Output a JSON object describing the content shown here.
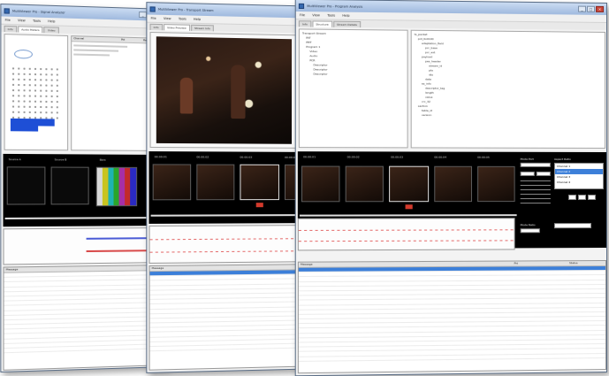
{
  "windows": {
    "a": {
      "title": "MultiViewer Pro - Signal Analyzer",
      "menu": [
        "File",
        "View",
        "Tools",
        "Help"
      ],
      "tabs": [
        "Info",
        "Audio Meters",
        "Video"
      ],
      "list_header": [
        "Channel",
        "Pid",
        "Rate"
      ],
      "thumb_labels": [
        "Source A",
        "Source B",
        "Bars"
      ],
      "log_header": "Message"
    },
    "b": {
      "title": "MultiViewer Pro - Transport Stream",
      "menu": [
        "File",
        "View",
        "Tools",
        "Help"
      ],
      "tabs": [
        "Info",
        "Video Preview",
        "Stream Info"
      ],
      "thumb_labels": [
        "00:00:01",
        "00:00:02",
        "00:00:03",
        "00:00:04"
      ],
      "log_header": "Message"
    },
    "c": {
      "title": "MultiViewer Pro - Program Analysis",
      "menu": [
        "File",
        "View",
        "Tools",
        "Help"
      ],
      "tabs": [
        "Info",
        "Structure",
        "Stream Details"
      ],
      "tree_left": [
        "Transport Stream",
        "PAT",
        "PMT",
        "Program 1",
        "Video",
        "Audio",
        "PCR",
        "Descriptor",
        "Descriptor",
        "Descriptor"
      ],
      "tree_right": [
        "ts_packet",
        "pid_0x0100",
        "adaptation_field",
        "pcr_base",
        "pcr_ext",
        "payload",
        "pes_header",
        "stream_id",
        "pts",
        "dts",
        "data",
        "es_info",
        "descriptor_tag",
        "length",
        "value",
        "crc_32",
        "section",
        "table_id",
        "version"
      ],
      "thumb_labels": [
        "00:00:01",
        "00:00:02",
        "00:00:03",
        "00:00:04",
        "00:00:05"
      ],
      "side_labels": [
        "Mode Port",
        "Aspect Ratio",
        "Mode Ratio"
      ],
      "side_list": [
        "Channel 1",
        "Channel 2",
        "Channel 3",
        "Channel 4"
      ],
      "log_columns": [
        "Message",
        "Pid",
        "Status"
      ]
    }
  },
  "colors": {
    "title_bar": "#a9c2e4",
    "selection": "#3c7fd9",
    "timeline_marker": "#d33a2c"
  }
}
